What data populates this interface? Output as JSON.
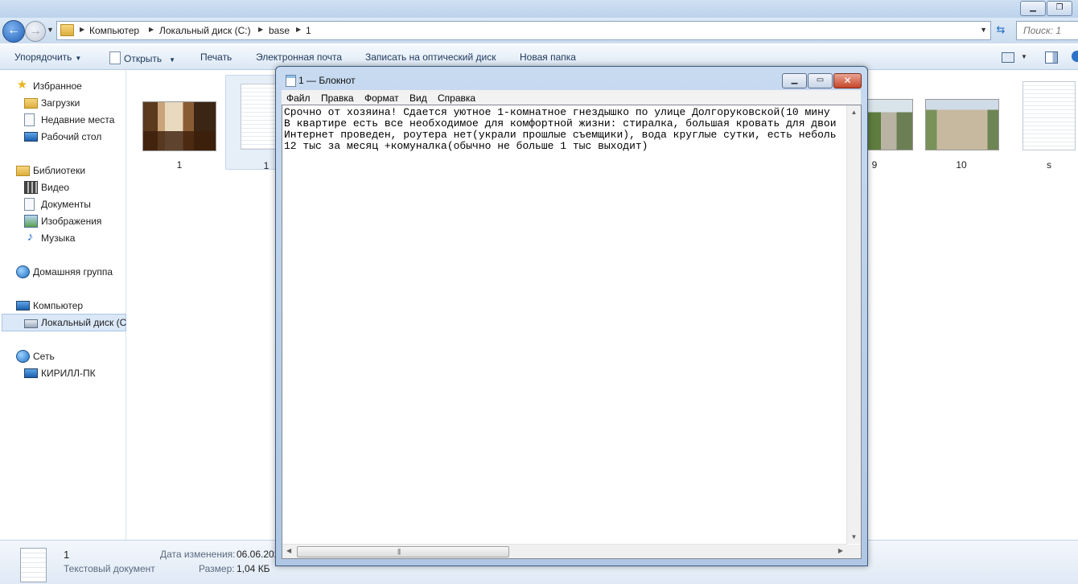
{
  "explorer": {
    "breadcrumbs": [
      "Компьютер",
      "Локальный диск (C:)",
      "base",
      "1"
    ],
    "search_placeholder": "Поиск: 1",
    "toolbar": {
      "organize": "Упорядочить",
      "open": "Открыть",
      "print": "Печать",
      "email": "Электронная почта",
      "burn": "Записать на оптический диск",
      "new_folder": "Новая папка"
    },
    "nav": {
      "favorites": "Избранное",
      "downloads": "Загрузки",
      "recent": "Недавние места",
      "desktop": "Рабочий стол",
      "libraries": "Библиотеки",
      "video": "Видео",
      "documents": "Документы",
      "images": "Изображения",
      "music": "Музыка",
      "homegroup": "Домашняя группа",
      "computer": "Компьютер",
      "local_disk": "Локальный диск (C",
      "network": "Сеть",
      "pc": "КИРИЛЛ-ПК"
    },
    "files": [
      {
        "name": "1",
        "kind": "photo-room"
      },
      {
        "name": "1",
        "kind": "text",
        "selected": true
      },
      {
        "name": "9",
        "kind": "photo-street"
      },
      {
        "name": "10",
        "kind": "photo-building"
      },
      {
        "name": "s",
        "kind": "text"
      }
    ],
    "details": {
      "name": "1",
      "type": "Текстовый документ",
      "modified_label": "Дата изменения:",
      "modified_value": "06.06.202",
      "size_label": "Размер:",
      "size_value": "1,04 КБ"
    }
  },
  "notepad": {
    "title": "1 — Блокнот",
    "menu": [
      "Файл",
      "Правка",
      "Формат",
      "Вид",
      "Справка"
    ],
    "lines": [
      "Срочно от хозяина! Сдается уютное 1-комнатное гнездышко по улице Долгоруковской(10 мину",
      "В квартире есть все необходимое для комфортной жизни: стиралка, большая кровать для двои",
      "Интернет проведен, роутера нет(украли прошлые съемщики), вода круглые сутки, есть неболь",
      "12 тыс за месяц +комуналка(обычно не больше 1 тыс выходит)"
    ]
  },
  "icons": {
    "back": "back-arrow-icon",
    "forward": "forward-arrow-icon",
    "refresh": "refresh-icon",
    "close": "close-icon",
    "minimize": "minimize-icon",
    "maximize": "maximize-icon"
  }
}
